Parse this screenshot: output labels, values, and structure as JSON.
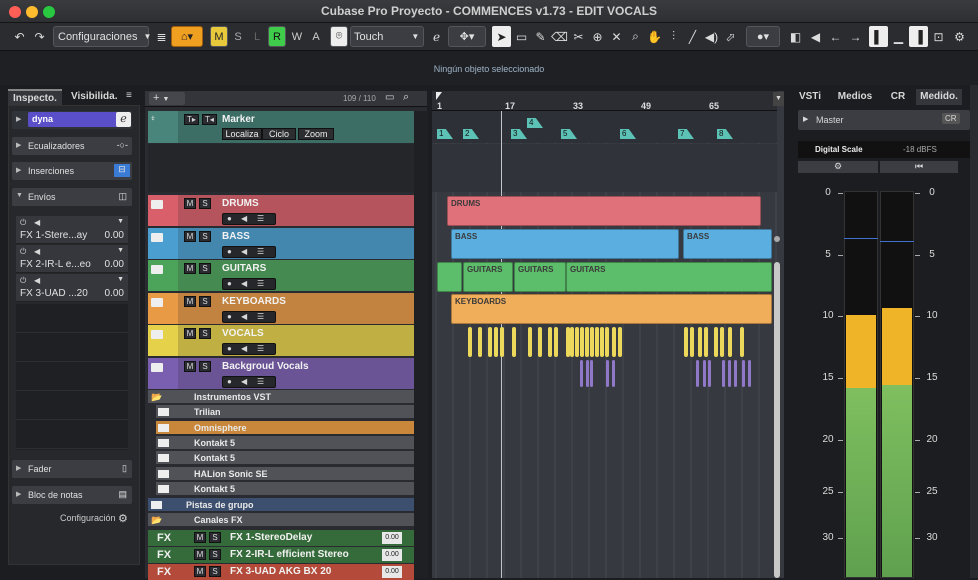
{
  "window": {
    "title": "Cubase Pro Proyecto - COMMENCES v1.73 - EDIT VOCALS"
  },
  "toolbar": {
    "config_label": "Configuraciones",
    "mode_m": "M",
    "mode_s": "S",
    "mode_l": "L",
    "mode_r": "R",
    "mode_w": "W",
    "mode_a": "A",
    "automation_mode": "Touch"
  },
  "status": {
    "selection": "Ningún objeto seleccionado"
  },
  "inspector": {
    "tab_inspector": "Inspecto.",
    "tab_visibility": "Visibilida.",
    "track_name": "dyna",
    "sections": {
      "equalizers": "Ecualizadores",
      "inserts": "Inserciones",
      "sends": "Envíos",
      "fader": "Fader",
      "notepad": "Bloc de notas",
      "config": "Configuración"
    },
    "sends": [
      {
        "name": "FX 1-Stere...ay",
        "value": "0.00"
      },
      {
        "name": "FX 2-IR-L e...eo",
        "value": "0.00"
      },
      {
        "name": "FX 3-UAD ...20",
        "value": "0.00"
      }
    ]
  },
  "tracklist": {
    "count": "109 / 110",
    "add_label": "+",
    "marker": {
      "name": "Marker",
      "btn_locate": "Localiza",
      "btn_cycle": "Ciclo",
      "btn_zoom": "Zoom"
    },
    "tracks": [
      {
        "name": "DRUMS",
        "color": "#d95f6a"
      },
      {
        "name": "BASS",
        "color": "#4a9fd0"
      },
      {
        "name": "GUITARS",
        "color": "#4ca35a"
      },
      {
        "name": "KEYBOARDS",
        "color": "#e89a45"
      },
      {
        "name": "VOCALS",
        "color": "#e6d24a"
      },
      {
        "name": "Backgroud Vocals",
        "color": "#7a5fb0"
      }
    ],
    "folders": {
      "instruments": "Instrumentos VST",
      "group": "Pistas de grupo",
      "fx": "Canales FX"
    },
    "instruments": [
      "Trilian",
      "Omnisphere",
      "Kontakt 5",
      "Kontakt 5",
      "HALion Sonic SE",
      "Kontakt 5"
    ],
    "fx_tracks": [
      {
        "prefix": "FX",
        "name": "FX 1-StereoDelay",
        "value": "0.00"
      },
      {
        "prefix": "FX",
        "name": "FX 2-IR-L efficient Stereo",
        "value": "0.00"
      },
      {
        "prefix": "FX",
        "name": "FX 3-UAD AKG BX 20",
        "value": "0.00"
      }
    ],
    "ms_m": "M",
    "ms_s": "S"
  },
  "ruler": {
    "bars": [
      "1",
      "17",
      "33",
      "49",
      "65"
    ]
  },
  "markers": [
    "1",
    "2",
    "3",
    "4",
    "5",
    "6",
    "7",
    "8"
  ],
  "events": {
    "drums": "DRUMS",
    "bass": "BASS",
    "guitars": "GUITARS",
    "keyboards": "KEYBOARDS"
  },
  "rightpanel": {
    "tabs": [
      "VSTi",
      "Medios",
      "CR",
      "Medido."
    ],
    "master": "Master",
    "cr": "CR",
    "scale_label": "Digital Scale",
    "scale_value": "-18 dBFS",
    "meter_scale": [
      "0",
      "5",
      "10",
      "15",
      "20",
      "25",
      "30"
    ],
    "meter_left": {
      "level": 0.68,
      "peak": 0.6
    },
    "meter_right": {
      "level": 0.7,
      "peak": 0.62
    }
  }
}
